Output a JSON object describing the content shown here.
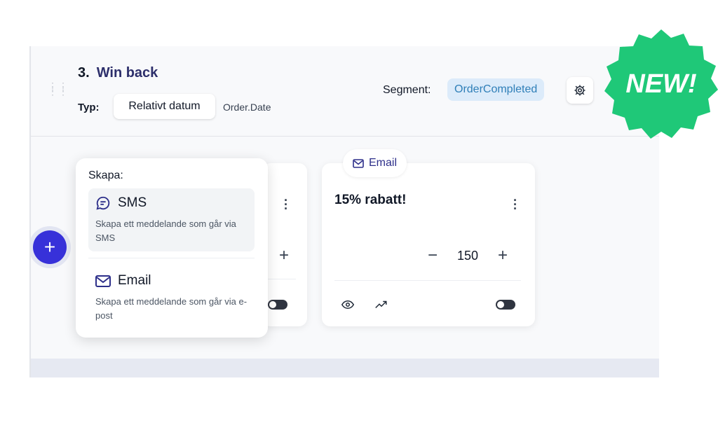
{
  "step": {
    "number": "3.",
    "name": "Win back"
  },
  "typ": {
    "label": "Typ:",
    "value": "Relativt datum",
    "field": "Order.Date"
  },
  "segment": {
    "label": "Segment:",
    "value": "OrderCompleted"
  },
  "icons": {
    "gear": "gear-icon",
    "drag": "drag-handle-icon",
    "email": "email-icon",
    "sms": "chat-icon",
    "eye": "eye-icon",
    "trend": "trend-icon"
  },
  "popup": {
    "header": "Skapa:",
    "options": [
      {
        "title": "SMS",
        "desc": "Skapa ett meddelande som går via SMS"
      },
      {
        "title": "Email",
        "desc": "Skapa ett meddelande som går via e-post"
      }
    ]
  },
  "card": {
    "tab": "Email",
    "title": "15% rabatt!",
    "value": "150",
    "minus": "−",
    "plus": "+"
  },
  "card_left": {
    "plus": "+"
  },
  "fab": {
    "plus": "+"
  },
  "badge": {
    "text": "NEW!"
  },
  "colors": {
    "accent": "#3731d9",
    "badge_green": "#1fc878",
    "segment_bg": "#dcebfa"
  }
}
